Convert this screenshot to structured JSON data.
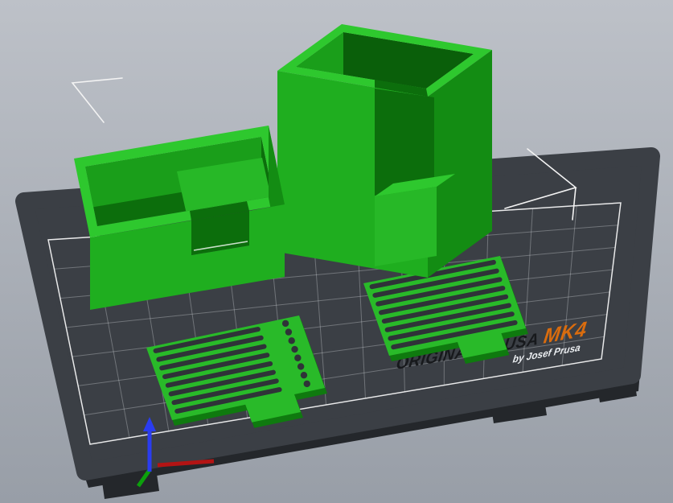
{
  "viewport": {
    "colors": {
      "top": "#bdc1c8",
      "bottom": "#989ea7",
      "marker": "#f3f3f3"
    }
  },
  "bed": {
    "labels": {
      "brand": "ORIGINAL PRUSA",
      "model": "MK4",
      "byline": "by Josef Prusa"
    },
    "colors": {
      "surface": "#3b3f45",
      "side": "#24272b",
      "grid": "rgba(235,238,242,0.30)",
      "boundary": "rgba(255,255,255,0.85)",
      "brand": "#17191c",
      "model": "#d96c0e",
      "byline": "#eceff2"
    }
  },
  "models": {
    "colors": {
      "top": "#2ec82e",
      "front": "#1fae1f",
      "side": "#138c13",
      "cavity": "#0c6e0c",
      "innerwall": "#1a9e1a",
      "innerdark": "#0a5f0a",
      "step": "#27b827",
      "plate": "#29ba29",
      "plateside": "#0f7a0f",
      "slot": "#2f3338"
    },
    "items": [
      {
        "name": "open-box"
      },
      {
        "name": "tall-box"
      },
      {
        "name": "slotted-plate-left"
      },
      {
        "name": "slotted-plate-right"
      }
    ]
  },
  "axis_gizmo": {
    "colors": {
      "x": "#b31414",
      "y": "#0ca00c",
      "z": "#2a3cf0"
    }
  }
}
